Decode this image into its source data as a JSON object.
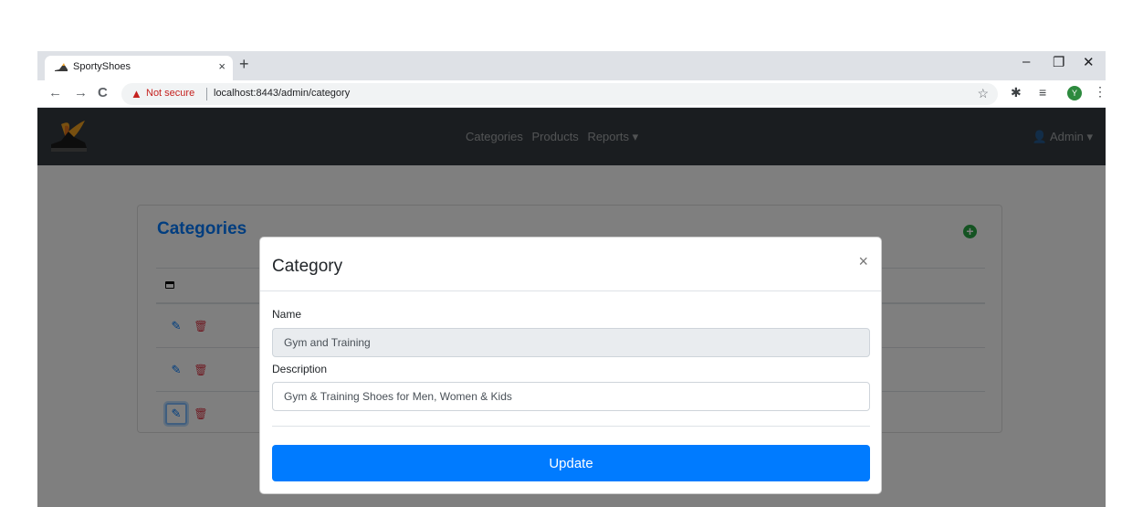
{
  "browser": {
    "tab_title": "SportyShoes",
    "tab_close": "×",
    "new_tab": "+",
    "window_controls": {
      "minimize": "–",
      "restore": "❐",
      "close": "✕"
    },
    "back": "←",
    "forward": "→",
    "reload": "C",
    "security_icon": "▲",
    "security_text": "Not secure",
    "url": "localhost:8443/admin/category",
    "bookmark_icon": "☆",
    "extension_icon": "✱",
    "reading_list_icon": "≡",
    "profile_initial": "Y",
    "menu_icon": "⋮"
  },
  "navbar": {
    "links": [
      "Categories",
      "Products",
      "Reports ▾"
    ],
    "user_icon": "👤",
    "user_label": "Admin ▾"
  },
  "card": {
    "title": "Categories",
    "add_icon": "+",
    "rows": [
      {
        "edit_icon": "✎",
        "delete_icon": "🗑"
      },
      {
        "edit_icon": "✎",
        "delete_icon": "🗑"
      },
      {
        "edit_icon": "✎",
        "delete_icon": "🗑"
      }
    ]
  },
  "modal": {
    "title": "Category",
    "close_icon": "×",
    "name_label": "Name",
    "name_value": "Gym and Training",
    "description_label": "Description",
    "description_value": "Gym & Training Shoes for Men, Women & Kids",
    "update_label": "Update"
  },
  "colors": {
    "navbar_bg": "#343a40",
    "primary": "#007bff",
    "success": "#28a745",
    "danger": "#dc3545"
  },
  "icons": {
    "favicon": "shoe-icon",
    "logo": "flaming-shoe-logo",
    "table_header": "window-icon"
  }
}
